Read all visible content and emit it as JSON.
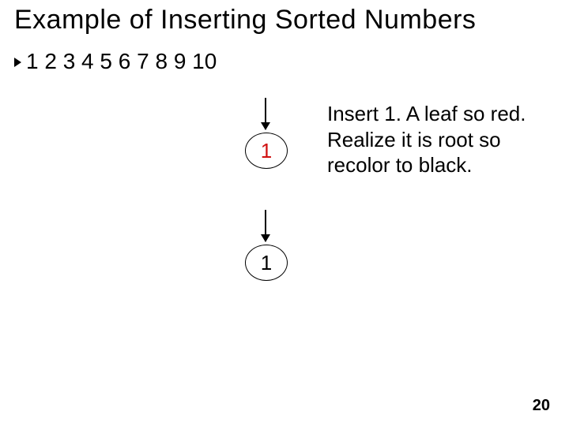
{
  "title": "Example of Inserting Sorted Numbers",
  "sequence": "1 2 3 4 5 6 7 8 9 10",
  "explanation": "Insert 1. A leaf so red. Realize it is root so recolor to black.",
  "node_red_label": "1",
  "node_black_label": "1",
  "page_number": "20"
}
